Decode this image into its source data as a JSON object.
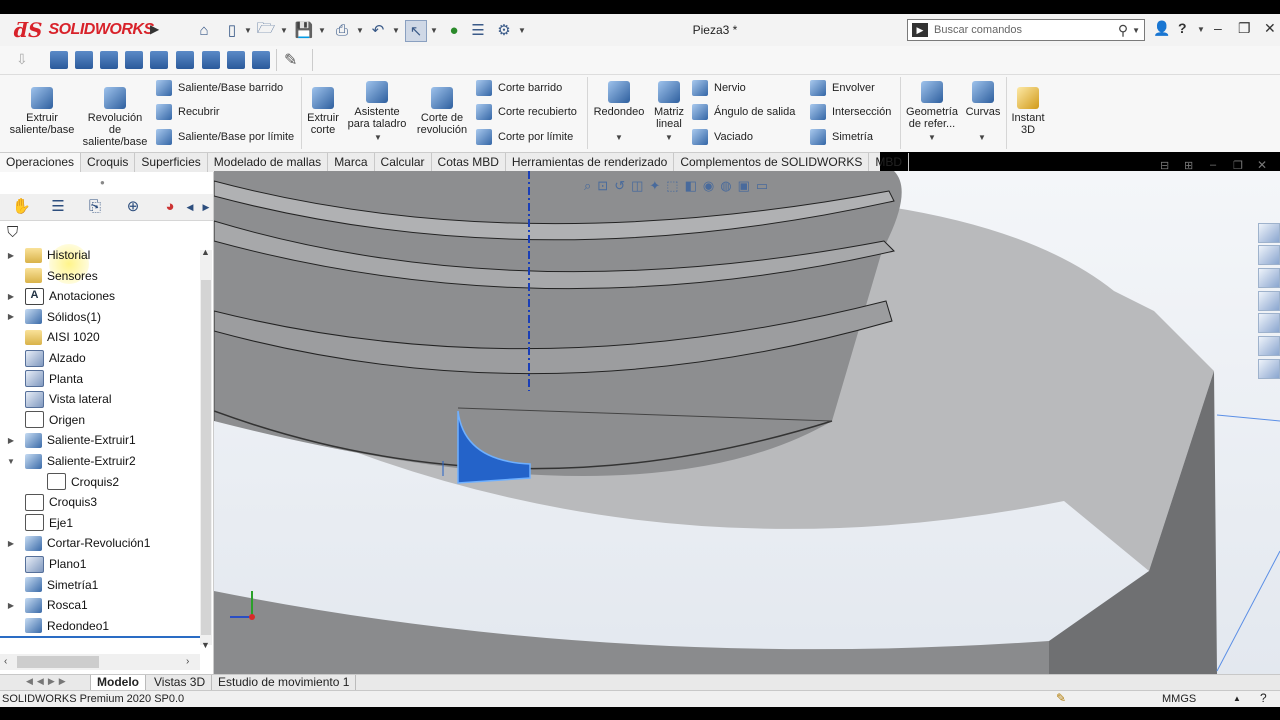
{
  "app": {
    "brand": "SOLIDWORKS",
    "brand_color": "#d8222a"
  },
  "title": {
    "document": "Pieza3 *"
  },
  "search": {
    "placeholder": "Buscar comandos"
  },
  "ribbon": {
    "extrude_boss": "Extruir saliente/base",
    "revolve_boss": "Revolución de saliente/base",
    "swept_boss": "Saliente/Base barrido",
    "recubrir": "Recubrir",
    "boundary_boss": "Saliente/Base por límite",
    "extrude_cut": "Extruir corte",
    "hole_wizard": "Asistente para taladro",
    "revolve_cut": "Corte de revolución",
    "swept_cut": "Corte barrido",
    "lofted_cut": "Corte recubierto",
    "boundary_cut": "Corte por límite",
    "fillet": "Redondeo",
    "linear_pattern": "Matriz lineal",
    "rib": "Nervio",
    "draft": "Ángulo de salida",
    "shell": "Vaciado",
    "wrap": "Envolver",
    "intersect": "Intersección",
    "mirror": "Simetría",
    "ref_geometry": "Geometría de refer...",
    "curves": "Curvas",
    "instant3d": "Instant 3D"
  },
  "tabs": [
    "Operaciones",
    "Croquis",
    "Superficies",
    "Modelado de mallas",
    "Marca",
    "Calcular",
    "Cotas MBD",
    "Herramientas de renderizado",
    "Complementos de SOLIDWORKS",
    "MBD"
  ],
  "tree": [
    {
      "label": "Historial",
      "expand": true
    },
    {
      "label": "Sensores",
      "expand": false
    },
    {
      "label": "Anotaciones",
      "expand": true
    },
    {
      "label": "Sólidos(1)",
      "expand": true
    },
    {
      "label": "AISI 1020",
      "expand": false
    },
    {
      "label": "Alzado",
      "expand": false
    },
    {
      "label": "Planta",
      "expand": false
    },
    {
      "label": "Vista lateral",
      "expand": false
    },
    {
      "label": "Origen",
      "expand": false
    },
    {
      "label": "Saliente-Extruir1",
      "expand": true
    },
    {
      "label": "Saliente-Extruir2",
      "expand": true
    },
    {
      "label": "Croquis2",
      "expand": false
    },
    {
      "label": "Croquis3",
      "expand": false
    },
    {
      "label": "Eje1",
      "expand": false
    },
    {
      "label": "Cortar-Revolución1",
      "expand": true
    },
    {
      "label": "Plano1",
      "expand": false
    },
    {
      "label": "Simetría1",
      "expand": false
    },
    {
      "label": "Rosca1",
      "expand": true
    },
    {
      "label": "Redondeo1",
      "expand": false
    }
  ],
  "bottom_tabs": [
    "Modelo",
    "Vistas 3D",
    "Estudio de movimiento 1"
  ],
  "status": {
    "left": "SOLIDWORKS Premium 2020 SP0.0",
    "units": "MMGS"
  }
}
